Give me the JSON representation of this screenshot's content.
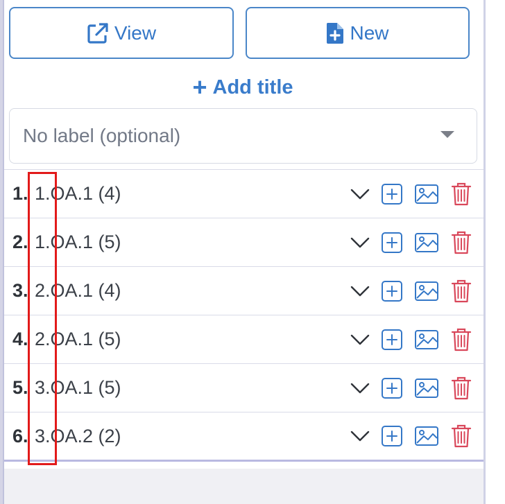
{
  "toolbar": {
    "view_label": "View",
    "new_label": "New",
    "add_title_label": "Add title",
    "add_title_prefix": "+"
  },
  "label_select": {
    "placeholder": "No label (optional)"
  },
  "items": [
    {
      "num": "1.",
      "code": "1.OA.1 (4)"
    },
    {
      "num": "2.",
      "code": "1.OA.1 (5)"
    },
    {
      "num": "3.",
      "code": "2.OA.1 (4)"
    },
    {
      "num": "4.",
      "code": "2.OA.1 (5)"
    },
    {
      "num": "5.",
      "code": "3.OA.1 (5)"
    },
    {
      "num": "6.",
      "code": "3.OA.2 (2)"
    }
  ],
  "icons": {
    "view": "external-link-icon",
    "new": "new-file-icon",
    "row_actions": [
      "chevron-down-icon",
      "plus-square-icon",
      "image-icon",
      "trash-icon"
    ]
  },
  "colors": {
    "accent": "#3477c7",
    "danger": "#d9475a",
    "annotation": "#e21a1a"
  }
}
